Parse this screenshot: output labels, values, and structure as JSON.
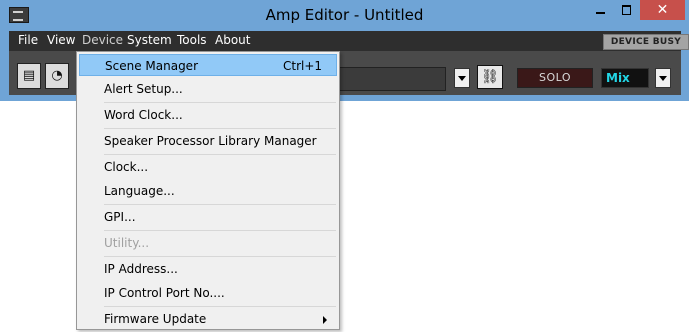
{
  "window": {
    "title": "Amp Editor - Untitled",
    "minimize_glyph": "",
    "close_glyph": "✕"
  },
  "menubar": {
    "items": [
      "File",
      "View",
      "Device",
      "System",
      "Tools",
      "About"
    ],
    "status": "DEVICE BUSY"
  },
  "toolbar": {
    "solo_label": "SOLO",
    "mix_value": "Mix"
  },
  "device_menu": {
    "items": [
      {
        "label": "Scene Manager",
        "shortcut": "Ctrl+1",
        "highlighted": true
      },
      {
        "label": "Alert Setup..."
      },
      {
        "label": "Word Clock..."
      },
      {
        "label": "Speaker Processor Library Manager"
      },
      {
        "label": "Clock..."
      },
      {
        "label": "Language..."
      },
      {
        "label": "GPI..."
      },
      {
        "label": "Utility...",
        "disabled": true
      },
      {
        "label": "IP Address..."
      },
      {
        "label": "IP Control Port No...."
      },
      {
        "label": "Firmware Update",
        "submenu": true
      }
    ]
  },
  "colors": {
    "titlebar": "#6fa4d6",
    "menubar": "#2e2e2e",
    "highlight": "#91c9f7",
    "close_button": "#c7504b",
    "mix_text": "#22d6e6"
  }
}
